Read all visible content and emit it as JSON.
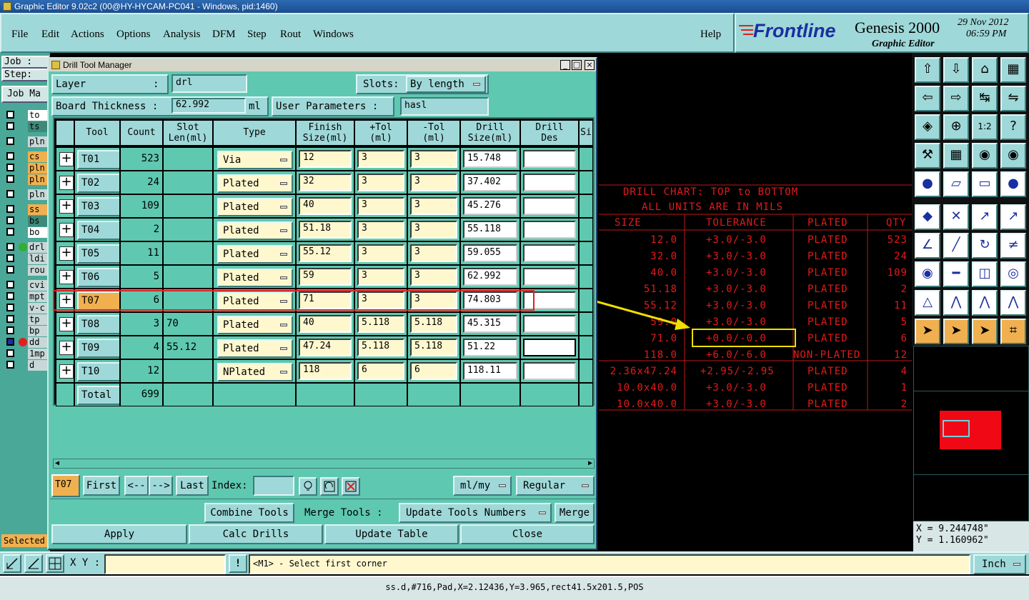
{
  "window": {
    "title": "Graphic Editor 9.02c2 (00@HY-HYCAM-PC041 - Windows, pid:1460)"
  },
  "menu": {
    "items": [
      "File",
      "Edit",
      "Actions",
      "Options",
      "Analysis",
      "DFM",
      "Step",
      "Rout",
      "Windows"
    ],
    "help": "Help"
  },
  "brand": {
    "logo": "Frontline",
    "product": "Genesis 2000",
    "subtitle": "Graphic Editor",
    "date": "29 Nov 2012",
    "time": "06:59 PM"
  },
  "left": {
    "job_label": "Job :",
    "step_label": "Step:",
    "job_manager": "Job Ma",
    "layers": [
      "to",
      "ts",
      "pln",
      "cs",
      "pln",
      "pln",
      "pln",
      "ss",
      "bs",
      "bo",
      "drl",
      "ldi",
      "rou",
      "cvi",
      "mpt",
      "v-c",
      "tp",
      "bp",
      "dd",
      "1mp",
      "d"
    ],
    "selected": "Selected"
  },
  "dialog": {
    "title": "Drill Tool Manager",
    "layer_label": "Layer",
    "layer_colon": ":",
    "layer_value": "drl",
    "slots_label": "Slots:",
    "slots_value": "By length",
    "thickness_label": "Board Thickness :",
    "thickness_value": "62.992",
    "thickness_unit": "ml",
    "user_params_label": "User Parameters :",
    "user_params_value": "hasl",
    "headers": [
      "Tool",
      "Count",
      "Slot\nLen(ml)",
      "Type",
      "Finish\nSize(ml)",
      "+Tol\n(ml)",
      "-Tol\n(ml)",
      "Drill\nSize(ml)",
      "Drill\nDes",
      "Si"
    ],
    "rows": [
      {
        "tool": "T01",
        "count": "523",
        "slot": "",
        "type": "Via",
        "finish": "12",
        "ptol": "3",
        "mtol": "3",
        "drill": "15.748"
      },
      {
        "tool": "T02",
        "count": "24",
        "slot": "",
        "type": "Plated",
        "finish": "32",
        "ptol": "3",
        "mtol": "3",
        "drill": "37.402"
      },
      {
        "tool": "T03",
        "count": "109",
        "slot": "",
        "type": "Plated",
        "finish": "40",
        "ptol": "3",
        "mtol": "3",
        "drill": "45.276"
      },
      {
        "tool": "T04",
        "count": "2",
        "slot": "",
        "type": "Plated",
        "finish": "51.18",
        "ptol": "3",
        "mtol": "3",
        "drill": "55.118"
      },
      {
        "tool": "T05",
        "count": "11",
        "slot": "",
        "type": "Plated",
        "finish": "55.12",
        "ptol": "3",
        "mtol": "3",
        "drill": "59.055"
      },
      {
        "tool": "T06",
        "count": "5",
        "slot": "",
        "type": "Plated",
        "finish": "59",
        "ptol": "3",
        "mtol": "3",
        "drill": "62.992"
      },
      {
        "tool": "T07",
        "count": "6",
        "slot": "",
        "type": "Plated",
        "finish": "71",
        "ptol": "3",
        "mtol": "3",
        "drill": "74.803"
      },
      {
        "tool": "T08",
        "count": "3",
        "slot": "70",
        "type": "Plated",
        "finish": "40",
        "ptol": "5.118",
        "mtol": "5.118",
        "drill": "45.315"
      },
      {
        "tool": "T09",
        "count": "4",
        "slot": "55.12",
        "type": "Plated",
        "finish": "47.24",
        "ptol": "5.118",
        "mtol": "5.118",
        "drill": "51.22"
      },
      {
        "tool": "T10",
        "count": "12",
        "slot": "",
        "type": "NPlated",
        "finish": "118",
        "ptol": "6",
        "mtol": "6",
        "drill": "118.11"
      }
    ],
    "total_label": "Total",
    "total_count": "699",
    "current_tool": "T07",
    "nav": {
      "first": "First",
      "prev": "<--",
      "next": "-->",
      "last": "Last",
      "index": "Index:"
    },
    "units_value": "ml/my",
    "mode_value": "Regular",
    "combine": "Combine Tools",
    "merge_tools": "Merge Tools :",
    "update_numbers": "Update Tools Numbers",
    "merge": "Merge",
    "apply": "Apply",
    "calc": "Calc Drills",
    "update_table": "Update Table",
    "close": "Close"
  },
  "drill_chart": {
    "title1": "DRILL CHART: TOP to BOTTOM",
    "title2": "ALL UNITS ARE IN MILS",
    "headers": [
      "SIZE",
      "TOLERANCE",
      "PLATED",
      "QTY"
    ],
    "rows": [
      [
        "12.0",
        "+3.0/-3.0",
        "PLATED",
        "523"
      ],
      [
        "32.0",
        "+3.0/-3.0",
        "PLATED",
        "24"
      ],
      [
        "40.0",
        "+3.0/-3.0",
        "PLATED",
        "109"
      ],
      [
        "51.18",
        "+3.0/-3.0",
        "PLATED",
        "2"
      ],
      [
        "55.12",
        "+3.0/-3.0",
        "PLATED",
        "11"
      ],
      [
        "59.0",
        "+3.0/-3.0",
        "PLATED",
        "5"
      ],
      [
        "71.0",
        "+0.0/-0.0",
        "PLATED",
        "6"
      ],
      [
        "118.0",
        "+6.0/-6.0",
        "NON-PLATED",
        "12"
      ],
      [
        "2.36x47.24",
        "+2.95/-2.95",
        "PLATED",
        "4"
      ],
      [
        "10.0x40.0",
        "+3.0/-3.0",
        "PLATED",
        "1"
      ],
      [
        "10.0x40.0",
        "+3.0/-3.0",
        "PLATED",
        "2"
      ]
    ]
  },
  "coords": {
    "x": "X = 9.244748\"",
    "y": "Y = 1.160962\""
  },
  "bottom": {
    "xy_label": "X Y :",
    "prompt": "<M1> - Select first corner",
    "units": "Inch"
  },
  "status": "ss.d,#716,Pad,X=2.12436,Y=3.965,rect41.5x201.5,POS",
  "colors": {
    "dialog_bg": "#5fc8b0",
    "panel": "#9fd8d8",
    "chart_red": "#e51a1a",
    "highlight_red": "#e02020",
    "highlight_yellow": "#f0e000"
  }
}
